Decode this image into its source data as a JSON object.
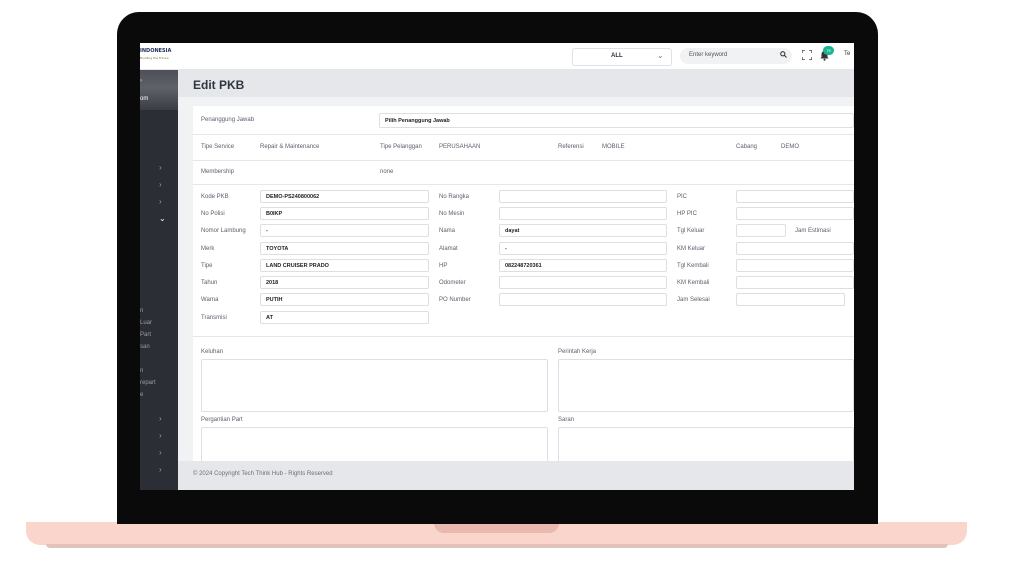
{
  "topbar": {
    "logo_title": "INDONESIA",
    "logo_sub": "Building the Future",
    "branch_select": "ALL",
    "search_placeholder": "Enter keyword",
    "notif_count": "75",
    "user_initial": "Te"
  },
  "sidebar": {
    "hero_label": "om",
    "menu_labels": [
      "n",
      "Luar",
      "Part",
      "san",
      "n",
      "repart",
      "e"
    ]
  },
  "page": {
    "title": "Edit PKB"
  },
  "form": {
    "penanggung_label": "Penanggung Jawab",
    "penanggung_value": "Pilih Penanggung Jawab",
    "tipe_service_label": "Tipe Service",
    "tipe_service_value": "Repair & Maintenance",
    "tipe_pelanggan_label": "Tipe Pelanggan",
    "tipe_pelanggan_value": "PERUSAHAAN",
    "referensi_label": "Referensi",
    "referensi_value": "MOBILE",
    "cabang_label": "Cabang",
    "cabang_value": "DEMO",
    "membership_label": "Membership",
    "membership_value": "none",
    "col1": [
      {
        "label": "Kode PKB",
        "value": "DEMO-PS240800062"
      },
      {
        "label": "No Polisi",
        "value": "B0IKP"
      },
      {
        "label": "Nomor Lambung",
        "value": "-"
      },
      {
        "label": "Merk",
        "value": "TOYOTA"
      },
      {
        "label": "Tipe",
        "value": "LAND CRUISER PRADO"
      },
      {
        "label": "Tahun",
        "value": "2018"
      },
      {
        "label": "Warna",
        "value": "PUTIH"
      },
      {
        "label": "Transmisi",
        "value": "AT"
      }
    ],
    "col2": [
      {
        "label": "No Rangka",
        "value": ""
      },
      {
        "label": "No Mesin",
        "value": ""
      },
      {
        "label": "Nama",
        "value": "dayat"
      },
      {
        "label": "Alamat",
        "value": "-"
      },
      {
        "label": "HP",
        "value": "082248720361"
      },
      {
        "label": "Odometer",
        "value": ""
      },
      {
        "label": "PO Number",
        "value": ""
      }
    ],
    "col3": [
      {
        "label": "PIC",
        "value": ""
      },
      {
        "label": "HP PIC",
        "value": ""
      },
      {
        "label": "Tgl Keluar",
        "value": ""
      },
      {
        "label": "KM Keluar",
        "value": ""
      },
      {
        "label": "Tgl Kembali",
        "value": ""
      },
      {
        "label": "KM Kembali",
        "value": ""
      },
      {
        "label": "Jam Selesai",
        "value": ""
      }
    ],
    "jam_estimasi_label": "Jam Estimasi",
    "keluhan_label": "Keluhan",
    "perintah_kerja_label": "Perintah Kerja",
    "pergantian_part_label": "Pergantian Part",
    "saran_label": "Saran"
  },
  "footer": {
    "copyright": "© 2024 Copyright Tech Think Hub - Rights Reserved"
  }
}
